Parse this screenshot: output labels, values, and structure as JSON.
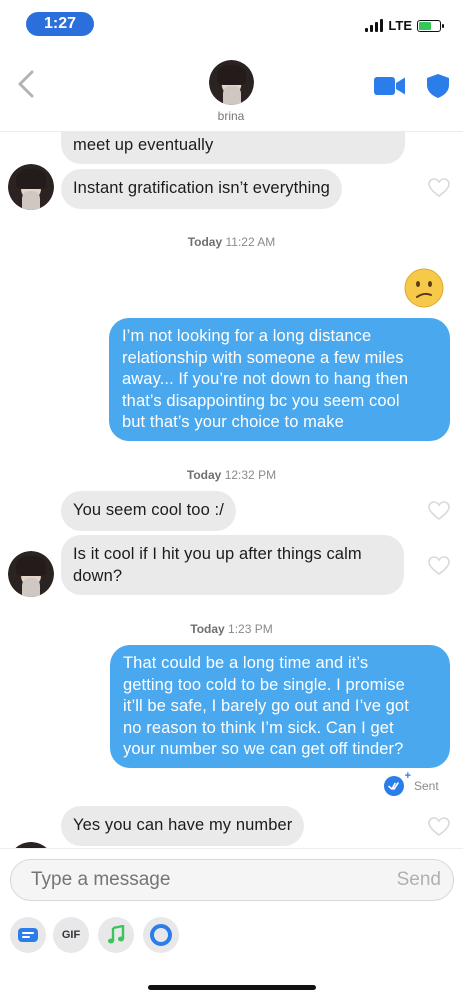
{
  "status_bar": {
    "time": "1:27",
    "network": "LTE"
  },
  "header": {
    "contact_name": "brina"
  },
  "messages": {
    "m1": "meet up eventually",
    "m2": "Instant gratification isn’t everything",
    "ts1_day": "Today",
    "ts1_time": "11:22 AM",
    "m3_l1": "I’m not looking for a long distance",
    "m3_l2": "relationship with someone a few miles",
    "m3_l3": "away... If you’re not down to hang then",
    "m3_l4": "that’s disappointing bc you seem cool",
    "m3_l5": "but that’s your choice to make",
    "ts2_day": "Today",
    "ts2_time": "12:32 PM",
    "m4": "You seem cool too :/",
    "m5_l1": "Is it cool if I hit you up after things calm",
    "m5_l2": "down?",
    "ts3_day": "Today",
    "ts3_time": "1:23 PM",
    "m6_l1": "That could be a long time and it’s",
    "m6_l2": "getting too cold to be single. I promise",
    "m6_l3": "it’ll be safe, I barely go out and I’ve got",
    "m6_l4": "no reason to think I’m sick. Can I get",
    "m6_l5": "your number so we can get off tinder?",
    "sent_status": "Sent",
    "m7": "Yes you can have my number"
  },
  "composer": {
    "placeholder": "Type a message",
    "send_label": "Send",
    "gif_label": "GIF"
  },
  "colors": {
    "sent_bubble": "#4aa8ee",
    "received_bubble": "#eaeaea",
    "accent": "#2b7de9"
  },
  "icons": [
    "chevron-left-icon",
    "video-camera-icon",
    "shield-icon",
    "heart-icon",
    "confused-face-emoji",
    "read-receipt-icon",
    "sticker-icon",
    "gif-icon",
    "music-note-icon",
    "circle-ring-icon"
  ]
}
